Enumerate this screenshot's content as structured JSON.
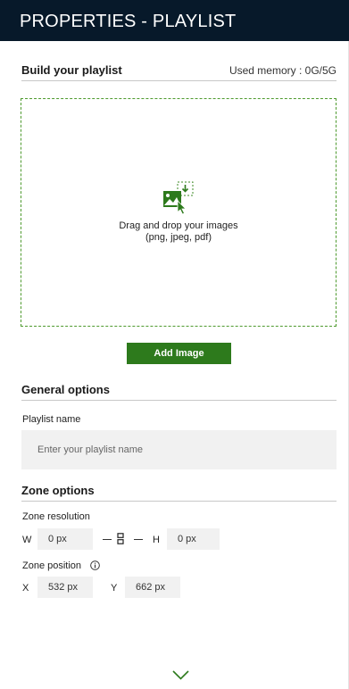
{
  "header": {
    "title": "PROPERTIES - PLAYLIST"
  },
  "build": {
    "title": "Build your playlist",
    "memory": "Used memory : 0G/5G",
    "drop_text_line1": "Drag and drop your images",
    "drop_text_line2": "(png, jpeg, pdf)",
    "add_button": "Add Image",
    "accent_color": "#2d7a1c"
  },
  "general": {
    "title": "General options",
    "playlist_name_label": "Playlist name",
    "playlist_name_placeholder": "Enter your playlist name",
    "playlist_name_value": ""
  },
  "zone": {
    "title": "Zone options",
    "resolution_label": "Zone resolution",
    "w_label": "W",
    "w_value": "0 px",
    "h_label": "H",
    "h_value": "0 px",
    "position_label": "Zone position",
    "x_label": "X",
    "x_value": "532 px",
    "y_label": "Y",
    "y_value": "662 px"
  },
  "icons": {
    "drop": "image-upload-icon",
    "link": "aspect-link-icon",
    "info": "info-icon",
    "expand": "chevron-down-icon"
  }
}
